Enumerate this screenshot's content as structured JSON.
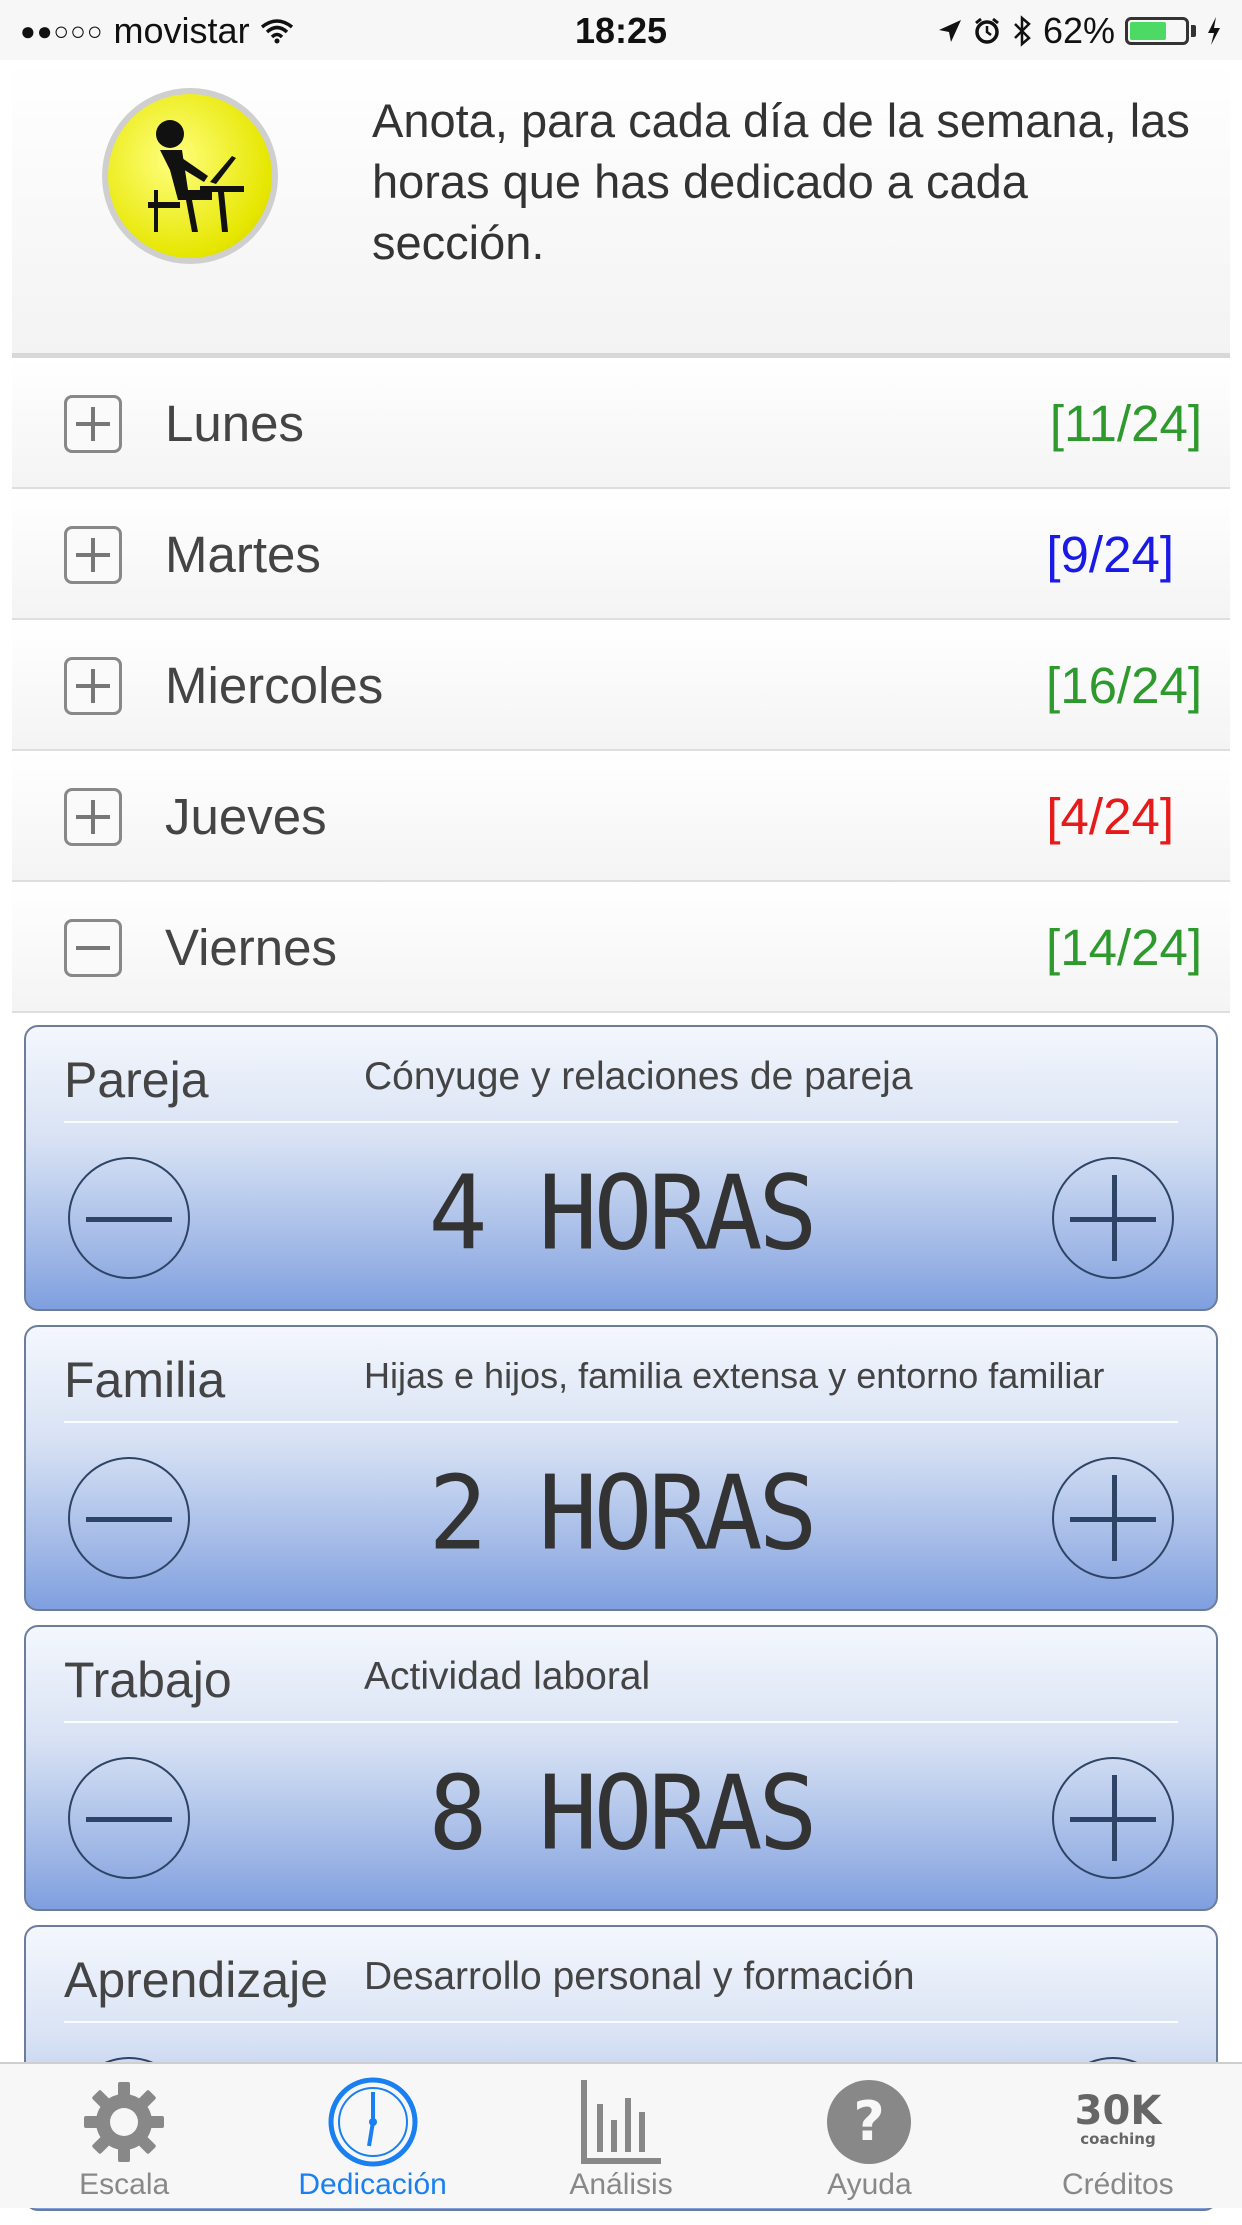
{
  "status_bar": {
    "signal": "●●○○○",
    "carrier": "movistar",
    "time": "18:25",
    "battery_percent": "62%",
    "battery_level": 0.62
  },
  "header": {
    "instruction": "Anota, para cada día de la semana, las horas que has dedicado a cada sección."
  },
  "days": [
    {
      "name": "Lunes",
      "count": "[11/24]",
      "color": "#2e9a2e",
      "expanded": false
    },
    {
      "name": "Martes",
      "count": "[9/24]",
      "color": "#1a1ae6",
      "expanded": false
    },
    {
      "name": "Miercoles",
      "count": "[16/24]",
      "color": "#2e9a2e",
      "expanded": false
    },
    {
      "name": "Jueves",
      "count": "[4/24]",
      "color": "#e61a1a",
      "expanded": false
    },
    {
      "name": "Viernes",
      "count": "[14/24]",
      "color": "#2e9a2e",
      "expanded": true
    }
  ],
  "sections": [
    {
      "title": "Pareja",
      "description": "Cónyuge y relaciones de pareja",
      "value": "4 HORAS"
    },
    {
      "title": "Familia",
      "description": "Hijas e hijos, familia extensa y entorno familiar",
      "value": "2 HORAS"
    },
    {
      "title": "Trabajo",
      "description": "Actividad laboral",
      "value": "8 HORAS"
    },
    {
      "title": "Aprendizaje",
      "description": "Desarrollo personal y formación",
      "value": ""
    }
  ],
  "tabs": [
    {
      "label": "Escala",
      "icon": "gear-icon",
      "active": false
    },
    {
      "label": "Dedicación",
      "icon": "clock-icon",
      "active": true
    },
    {
      "label": "Análisis",
      "icon": "chart-icon",
      "active": false
    },
    {
      "label": "Ayuda",
      "icon": "help-icon",
      "active": false
    },
    {
      "label": "Créditos",
      "icon": "30k-coaching-logo",
      "active": false
    }
  ],
  "colors": {
    "accent": "#1a7ff0",
    "inactive_tab": "#888888",
    "card_dark": "#7f9fdf"
  }
}
